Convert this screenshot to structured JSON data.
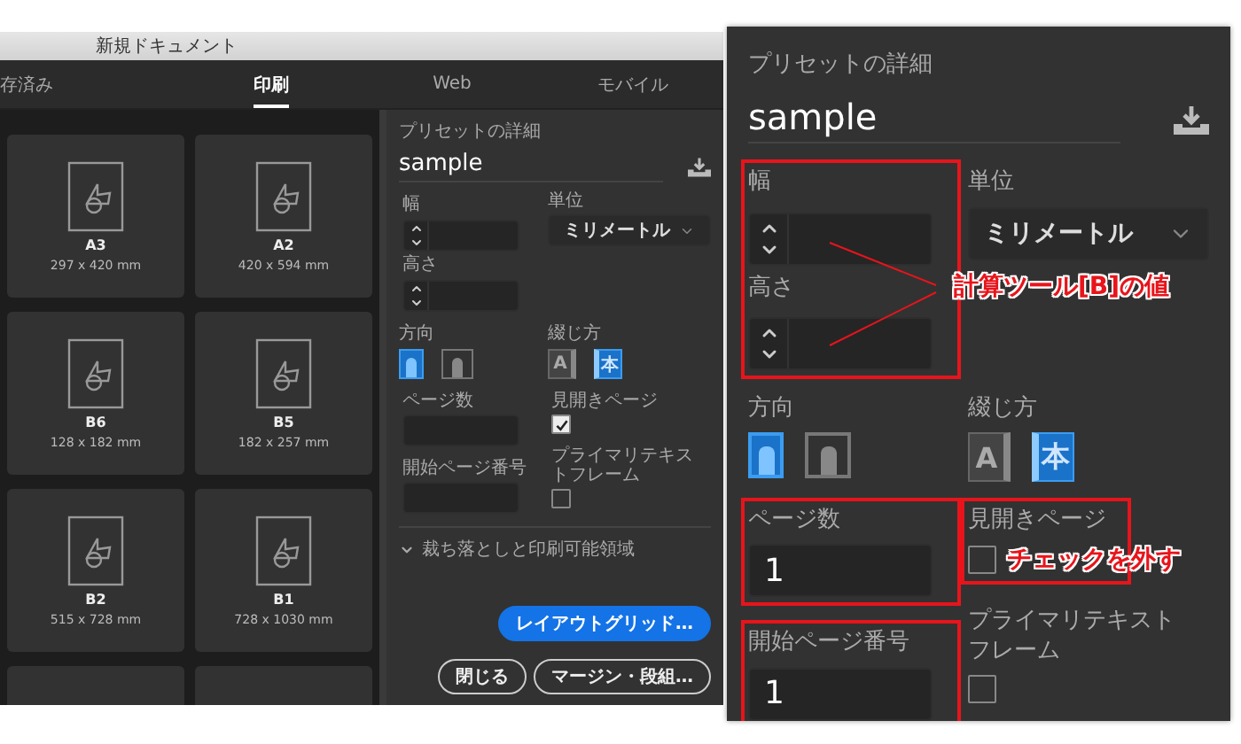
{
  "left_window": {
    "title": "新規ドキュメント",
    "tabs": [
      {
        "label": "存済み",
        "selected": false
      },
      {
        "label": "印刷",
        "selected": true
      },
      {
        "label": "Web",
        "selected": false
      },
      {
        "label": "モバイル",
        "selected": false
      }
    ],
    "presets": [
      {
        "name": "A3",
        "size": "297 x 420 mm"
      },
      {
        "name": "A2",
        "size": "420 x 594 mm"
      },
      {
        "name": "B6",
        "size": "128 x 182 mm"
      },
      {
        "name": "B5",
        "size": "182 x 257 mm"
      },
      {
        "name": "B2",
        "size": "515 x 728 mm"
      },
      {
        "name": "B1",
        "size": "728 x 1030 mm"
      }
    ],
    "details": {
      "heading": "プリセットの詳細",
      "preset_name": "sample",
      "size_highlight": false,
      "width": {
        "label": "幅"
      },
      "height": {
        "label": "高さ"
      },
      "unit": {
        "label": "単位",
        "value": "ミリメートル"
      },
      "orientation": {
        "label": "方向",
        "options": [
          {
            "kind": "portrait",
            "selected": true
          },
          {
            "kind": "landscape",
            "selected": false
          }
        ]
      },
      "binding": {
        "label": "綴じ方",
        "options": [
          {
            "kind": "left",
            "glyph": "A",
            "selected": false
          },
          {
            "kind": "right",
            "glyph": "本",
            "selected": true
          }
        ]
      },
      "pages": {
        "label": "ページ数",
        "highlight": false
      },
      "facing": {
        "label": "見開きページ",
        "checked": true,
        "highlight": false
      },
      "start": {
        "label": "開始ページ番号",
        "highlight": false
      },
      "primary_frame": {
        "label": "プライマリテキストフレーム",
        "checked": false
      },
      "bleed": {
        "label": "裁ち落としと印刷可能領域"
      },
      "buttons": [
        {
          "label": "レイアウトグリッド…",
          "kind": "primary"
        },
        {
          "label": "閉じる",
          "kind": "outline"
        },
        {
          "label": "マージン・段組…",
          "kind": "outline"
        }
      ]
    }
  },
  "zoom_panel": {
    "details": {
      "heading": "プリセットの詳細",
      "preset_name": "sample",
      "size_highlight": true,
      "width": {
        "label": "幅"
      },
      "height": {
        "label": "高さ"
      },
      "unit": {
        "label": "単位",
        "value": "ミリメートル"
      },
      "orientation": {
        "label": "方向",
        "options": [
          {
            "kind": "portrait",
            "selected": true
          },
          {
            "kind": "landscape",
            "selected": false
          }
        ]
      },
      "binding": {
        "label": "綴じ方",
        "options": [
          {
            "kind": "left",
            "glyph": "A",
            "selected": false
          },
          {
            "kind": "right",
            "glyph": "本",
            "selected": true
          }
        ]
      },
      "pages": {
        "label": "ページ数",
        "value": "1",
        "highlight": true
      },
      "facing": {
        "label": "見開きページ",
        "checked": false,
        "highlight": true
      },
      "start": {
        "label": "開始ページ番号",
        "value": "1",
        "highlight": true
      },
      "primary_frame": {
        "label": "プライマリテキストフレーム",
        "checked": false
      }
    },
    "callouts": [
      {
        "text": "計算ツール[B]の値"
      },
      {
        "text": "チェックを外す"
      }
    ]
  }
}
